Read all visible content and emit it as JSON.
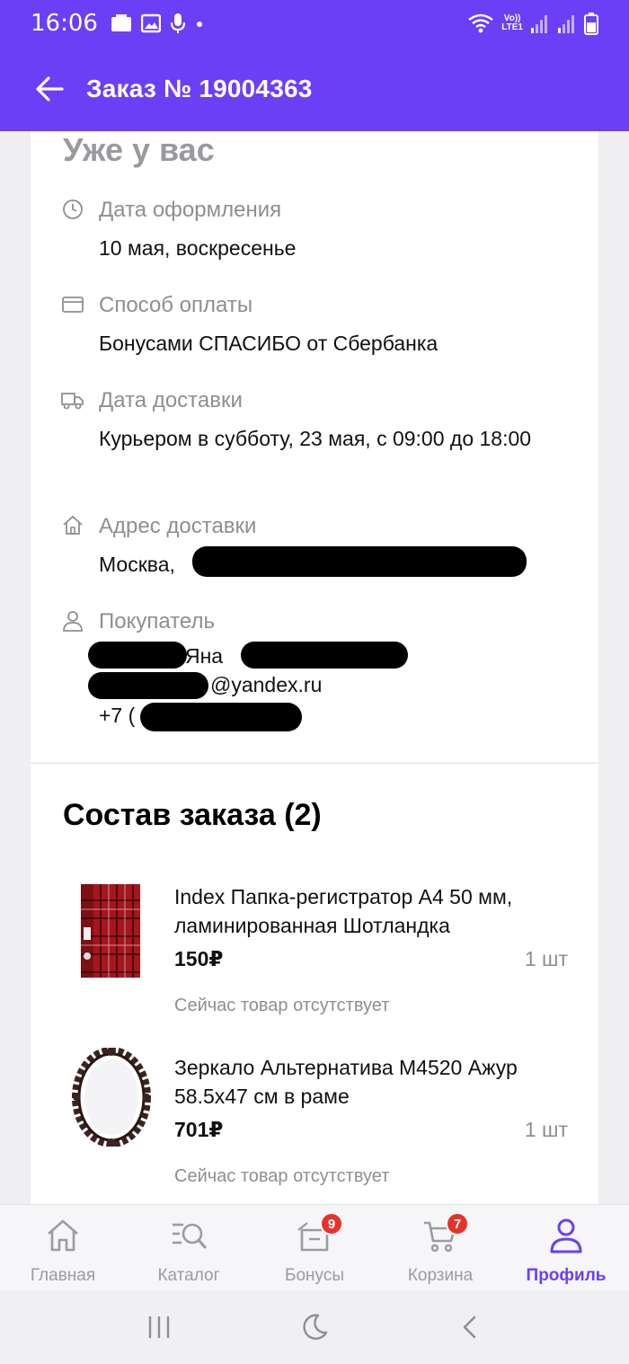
{
  "status_bar": {
    "time": "16:06",
    "lte": "LTE1",
    "volte": "Vo))"
  },
  "app_bar": {
    "title": "Заказ № 19004363"
  },
  "summary": {
    "section_title": "Уже у вас",
    "order_date": {
      "label": "Дата оформления",
      "value": "10 мая, воскресенье"
    },
    "payment": {
      "label": "Способ оплаты",
      "value": "Бонусами СПАСИБО от Сбербанка"
    },
    "delivery_date": {
      "label": "Дата доставки",
      "value": "Курьером в субботу, 23 мая, с 09:00 до 18:00"
    },
    "address": {
      "label": "Адрес доставки",
      "value": "Москва,"
    },
    "buyer": {
      "label": "Покупатель",
      "name": "Яна",
      "email": "@yandex.ru",
      "phone": "+7 ("
    }
  },
  "order": {
    "heading": "Состав заказа (2)",
    "items": [
      {
        "name": "Index Папка-регистратор А4 50 мм, ламинированная Шотландка",
        "price": "150₽",
        "qty": "1 шт",
        "stock": "Сейчас товар отсутствует"
      },
      {
        "name": "Зеркало Альтернатива М4520 Ажур 58.5х47 см в раме",
        "price": "701₽",
        "qty": "1 шт",
        "stock": "Сейчас товар отсутствует"
      }
    ]
  },
  "bottom_nav": {
    "items": [
      {
        "label": "Главная",
        "icon": "home-icon"
      },
      {
        "label": "Каталог",
        "icon": "catalog-search-icon"
      },
      {
        "label": "Бонусы",
        "icon": "gift-box-icon",
        "badge": "9"
      },
      {
        "label": "Корзина",
        "icon": "cart-icon",
        "badge": "7"
      },
      {
        "label": "Профиль",
        "icon": "profile-icon",
        "active": true
      }
    ]
  },
  "colors": {
    "accent": "#6a3ff5",
    "badge": "#e6332a",
    "muted": "#8e8e93"
  }
}
